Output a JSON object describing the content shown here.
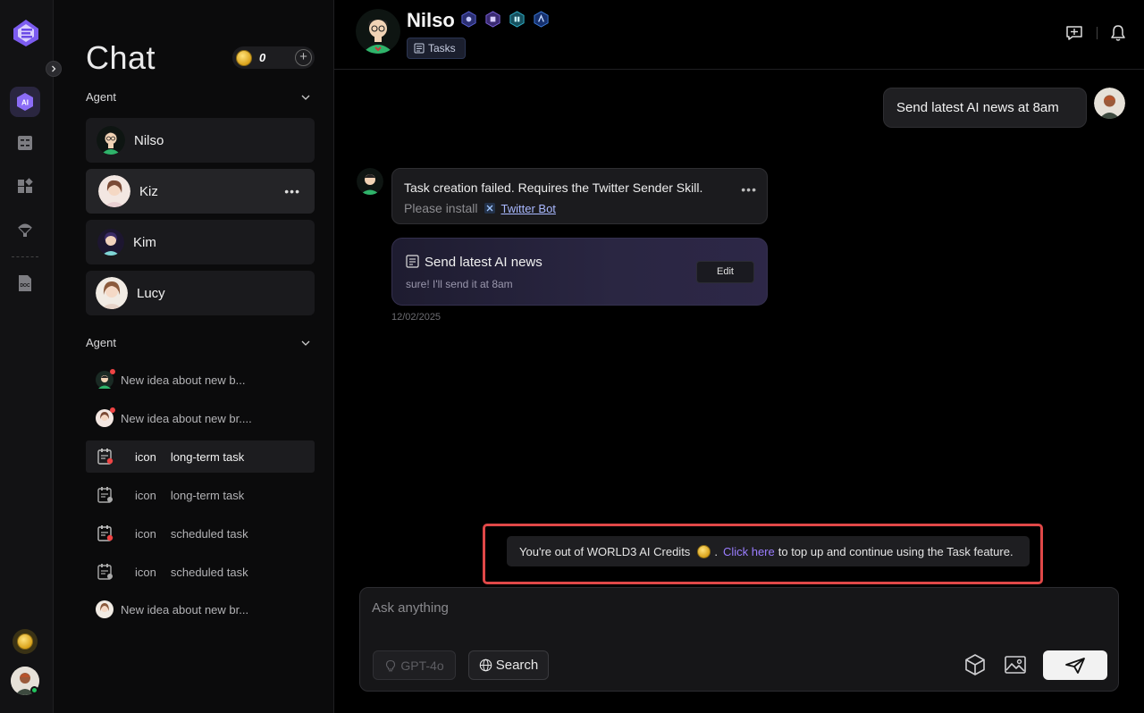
{
  "sidebar": {
    "title": "Chat",
    "credits": "0",
    "agent_section": "Agent",
    "agents": [
      {
        "name": "Nilso"
      },
      {
        "name": "Kiz"
      },
      {
        "name": "Kim"
      },
      {
        "name": "Lucy"
      }
    ],
    "conv_section": "Agent",
    "conversations": [
      {
        "text": "New idea about new b...",
        "type": "chat"
      },
      {
        "text": "New idea about new br....",
        "type": "chat"
      },
      {
        "icon_word": "icon",
        "text": "long-term task",
        "type": "task"
      },
      {
        "icon_word": "icon",
        "text": "long-term task",
        "type": "task"
      },
      {
        "icon_word": "icon",
        "text": "scheduled task",
        "type": "task"
      },
      {
        "icon_word": "icon",
        "text": "scheduled task",
        "type": "task"
      },
      {
        "text": "New idea about new br...",
        "type": "chat"
      }
    ]
  },
  "header": {
    "bot_name": "Nilso",
    "tasks_label": "Tasks"
  },
  "messages": {
    "user_text": "Send latest AI news at 8am",
    "bot_line1": "Task creation failed. Requires the Twitter Sender Skill.",
    "bot_line2_prefix": "Please install",
    "bot_link": "Twitter Bot",
    "task_title": "Send latest AI news",
    "task_subtitle": "sure! I'll send it at 8am",
    "edit_label": "Edit",
    "date": "12/02/2025"
  },
  "alert": {
    "prefix": "You're out of WORLD3 AI Credits",
    "dot": ".",
    "link": "Click here",
    "suffix": "to top up and continue using the Task feature."
  },
  "composer": {
    "placeholder": "Ask anything",
    "model_label": "GPT-4o",
    "search_label": "Search"
  },
  "colors": {
    "accent": "#8b6cf6",
    "alert_border": "#e04848",
    "link": "#9b7dff"
  },
  "icons": [
    "logo-icon",
    "chevron-right-icon",
    "ai-icon",
    "tasks-icon",
    "apps-icon",
    "parachute-icon",
    "doc-icon",
    "coin-icon",
    "chat-bubble-icon",
    "bell-icon",
    "cube-icon",
    "image-icon",
    "send-icon",
    "globe-icon",
    "bulb-icon"
  ]
}
